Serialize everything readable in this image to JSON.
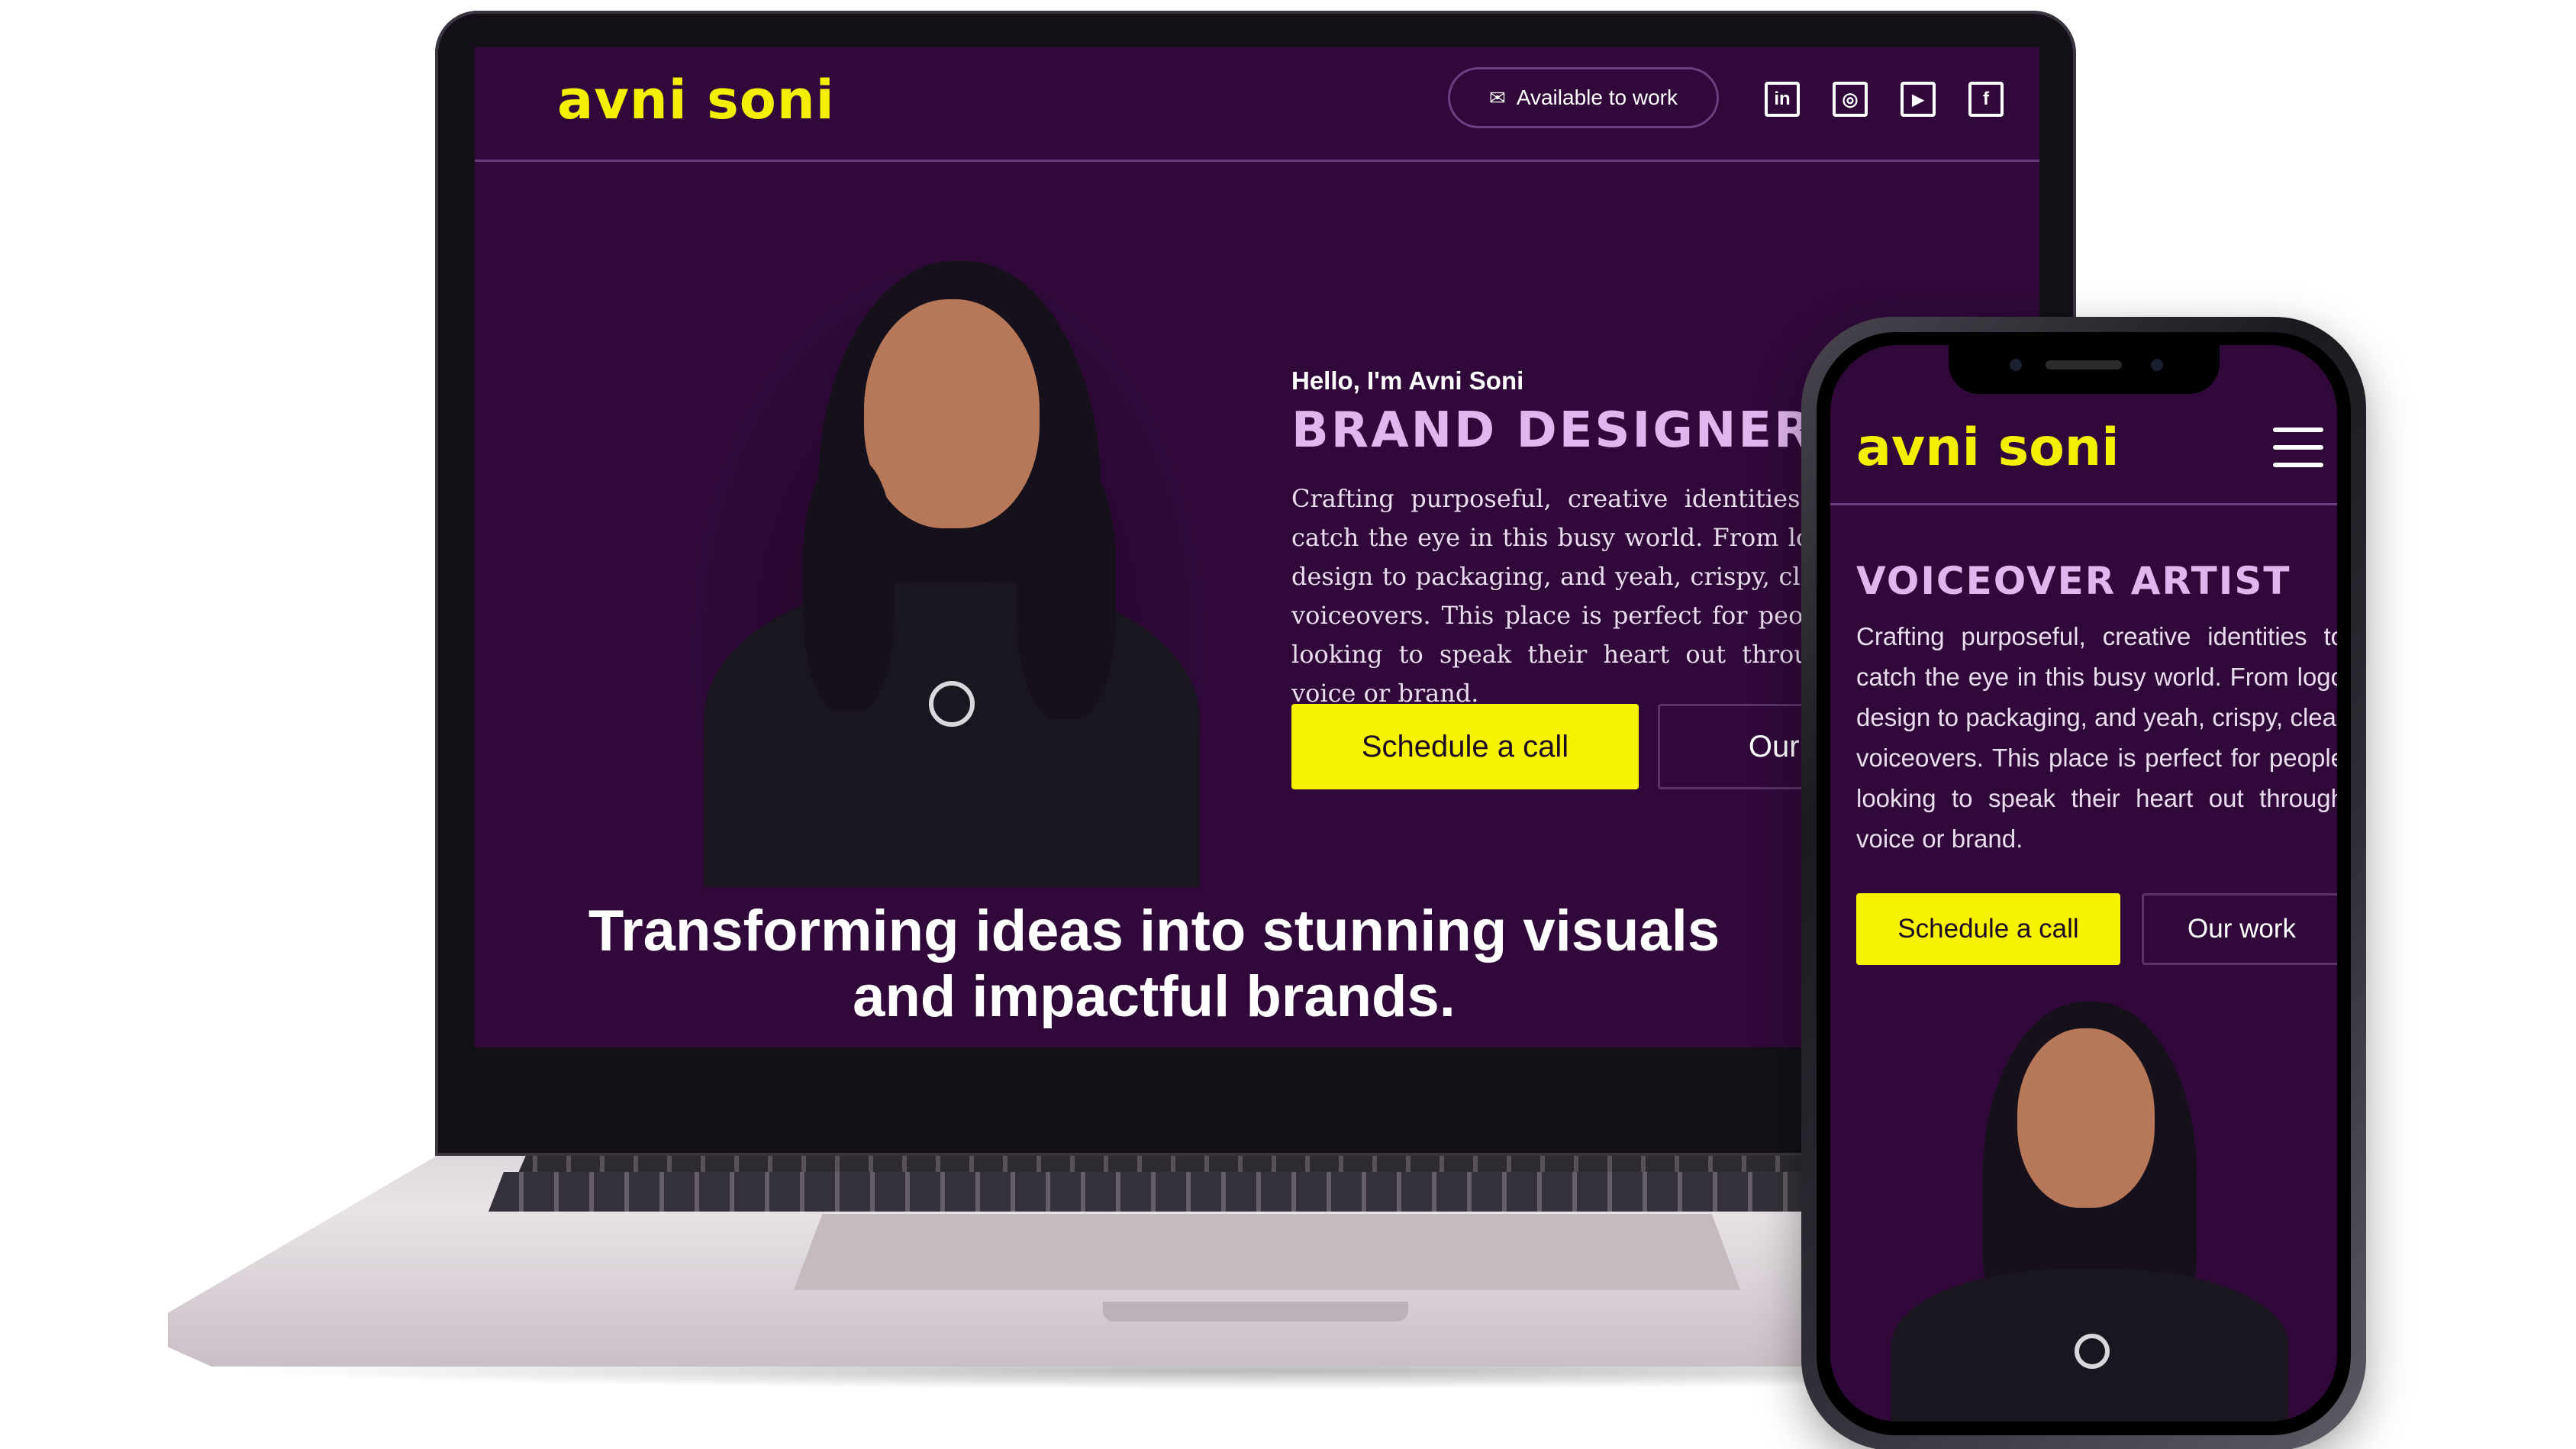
{
  "colors": {
    "page_bg": "#30093a",
    "logo": "#f4ef00",
    "accent_button": "#f7f200",
    "heading_role": "#e1b6ee",
    "divider": "#6a3a7e"
  },
  "laptop": {
    "logo": "avni soni",
    "available_label": "Available to work",
    "available_icon": "envelope-icon",
    "social": [
      {
        "name": "linkedin-icon",
        "glyph": "in"
      },
      {
        "name": "instagram-icon",
        "glyph": "◎"
      },
      {
        "name": "twitter-icon",
        "glyph": "🐦"
      },
      {
        "name": "facebook-icon",
        "glyph": "f"
      }
    ],
    "hello": "Hello, I'm Avni Soni",
    "role": "BRAND DESIGNER |",
    "description": "Crafting purposeful, creative identities to catch the eye in this busy world. From logo design to packaging, and yeah, crispy, clear voiceovers. This place is perfect for people looking to speak their heart out through voice or brand.",
    "primary_button": "Schedule a call",
    "secondary_button": "Our work",
    "tagline": "Transforming ideas into stunning visuals and impactful brands."
  },
  "phone": {
    "logo": "avni soni",
    "menu_icon": "hamburger-menu-icon",
    "role": "VOICEOVER ARTIST",
    "description": "Crafting purposeful, creative identities to catch the eye in this busy world. From logo design to packaging, and yeah, crispy, clear voiceovers. This place is perfect for people looking to speak their heart out through voice or brand.",
    "primary_button": "Schedule a call",
    "secondary_button": "Our work"
  }
}
